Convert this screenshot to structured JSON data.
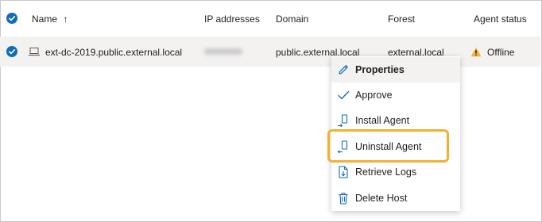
{
  "table": {
    "columns": {
      "name": "Name",
      "sort_indicator": "↑",
      "ip": "IP addresses",
      "domain": "Domain",
      "forest": "Forest",
      "agent_status": "Agent status"
    },
    "rows": [
      {
        "name": "ext-dc-2019.public.external.local",
        "domain": "public.external.local",
        "forest": "external.local",
        "status": "Offline"
      }
    ]
  },
  "context_menu": {
    "items": [
      {
        "label": "Properties",
        "icon": "pencil-icon"
      },
      {
        "label": "Approve",
        "icon": "checkmark-icon"
      },
      {
        "label": "Install Agent",
        "icon": "install-agent-icon"
      },
      {
        "label": "Uninstall Agent",
        "icon": "uninstall-agent-icon"
      },
      {
        "label": "Retrieve Logs",
        "icon": "retrieve-logs-icon"
      },
      {
        "label": "Delete Host",
        "icon": "trash-icon"
      }
    ]
  },
  "colors": {
    "accent": "#0f6cbd",
    "highlight": "#f2b130",
    "warning": "#f2b130"
  }
}
